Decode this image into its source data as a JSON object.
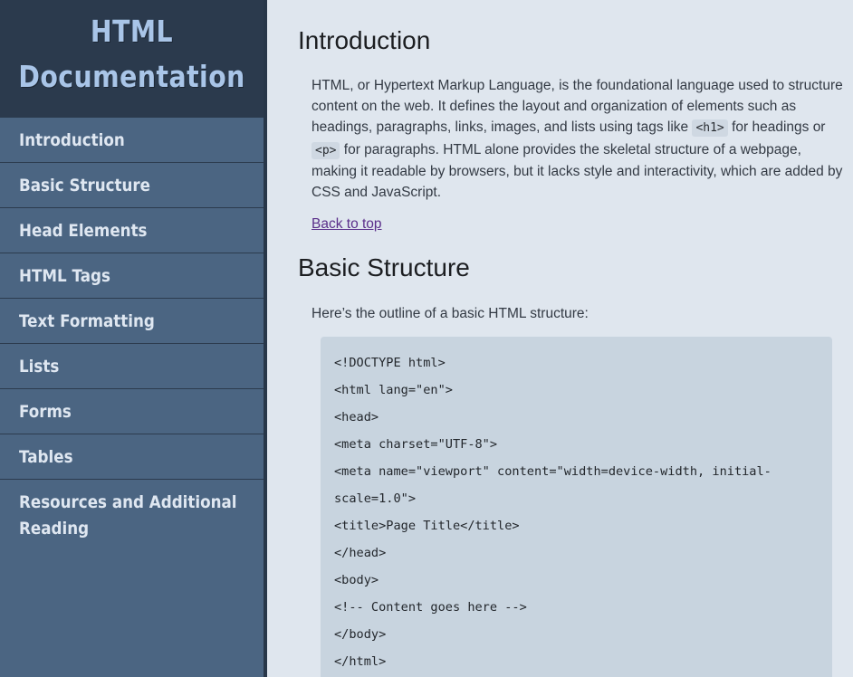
{
  "sidebar": {
    "title_line1": "HTML",
    "title_line2": "Documentation",
    "items": [
      {
        "label": "Introduction"
      },
      {
        "label": "Basic Structure"
      },
      {
        "label": "Head Elements"
      },
      {
        "label": "HTML Tags"
      },
      {
        "label": "Text Formatting"
      },
      {
        "label": "Lists"
      },
      {
        "label": "Forms"
      },
      {
        "label": "Tables"
      },
      {
        "label": "Resources and Additional Reading"
      }
    ]
  },
  "intro": {
    "title": "Introduction",
    "text_part1": "HTML, or Hypertext Markup Language, is the foundational language used to structure content on the web. It defines the layout and organization of elements such as headings, paragraphs, links, images, and lists using tags like ",
    "code1": "<h1>",
    "text_part2": " for headings or ",
    "code2": "<p>",
    "text_part3": " for paragraphs. HTML alone provides the skeletal structure of a webpage, making it readable by browsers, but it lacks style and interactivity, which are added by CSS and JavaScript.",
    "back_to_top": "Back to top"
  },
  "basic": {
    "title": "Basic Structure",
    "intro_text": "Here’s the outline of a basic HTML structure:",
    "code_lines": [
      "<!DOCTYPE html>",
      "<html lang=\"en\">",
      "<head>",
      "<meta charset=\"UTF-8\">",
      "<meta name=\"viewport\" content=\"width=device-width, initial-",
      "scale=1.0\">",
      "<title>Page Title</title>",
      "</head>",
      "<body>",
      "<!-- Content goes here -->",
      "</body>",
      "</html>"
    ]
  }
}
